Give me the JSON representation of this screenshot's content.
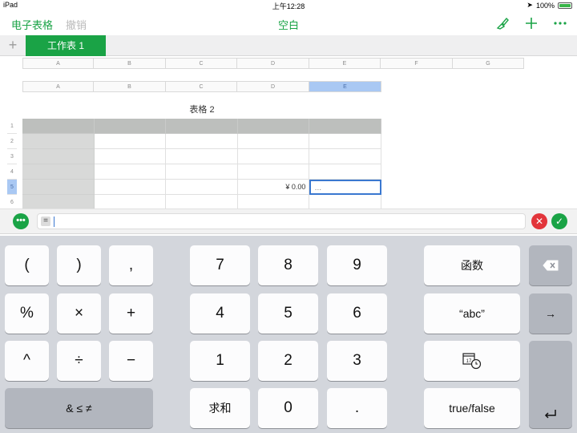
{
  "status": {
    "device": "iPad",
    "time": "上午12:28",
    "battery": "100%"
  },
  "toolbar": {
    "spreadsheets_label": "电子表格",
    "undo_label": "撤销",
    "title": "空白"
  },
  "tabs": {
    "add": "+",
    "active_label": "工作表 1"
  },
  "sheet": {
    "columns_top": [
      "A",
      "B",
      "C",
      "D",
      "E",
      "F",
      "G"
    ],
    "columns": [
      "A",
      "B",
      "C",
      "D",
      "E"
    ],
    "selected_column": "E",
    "table_title": "表格 2",
    "rows": [
      "1",
      "2",
      "3",
      "4",
      "5",
      "6"
    ],
    "selected_row": "5",
    "value_cell": "¥ 0.00",
    "editing_cell": "…"
  },
  "formula_bar": {
    "menu": "•••",
    "equals": "=",
    "cancel": "✕",
    "accept": "✓"
  },
  "keyboard": {
    "lparen": "(",
    "rparen": ")",
    "comma": ",",
    "percent": "%",
    "times": "×",
    "plus": "+",
    "caret": "^",
    "divide": "÷",
    "minus": "−",
    "operators": "& ≤ ≠",
    "d7": "7",
    "d8": "8",
    "d9": "9",
    "d4": "4",
    "d5": "5",
    "d6": "6",
    "d1": "1",
    "d2": "2",
    "d3": "3",
    "sum": "求和",
    "d0": "0",
    "dot": ".",
    "functions": "函数",
    "text": "“abc”",
    "date_badge": "17",
    "boolean": "true/false",
    "delete": "⌫",
    "tab": "→",
    "return": "↵"
  }
}
